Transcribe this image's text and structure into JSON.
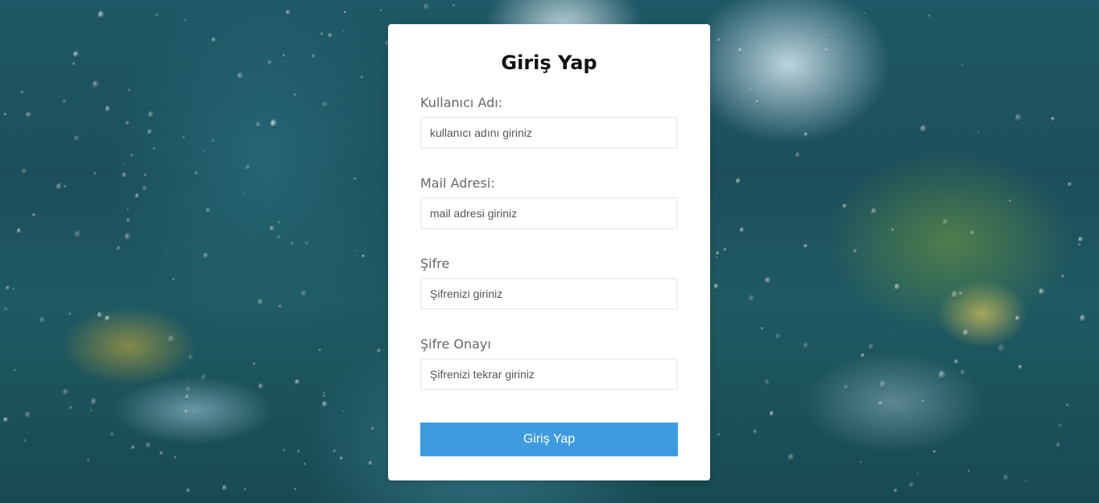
{
  "form": {
    "title": "Giriş Yap",
    "fields": [
      {
        "label": "Kullanıcı Adı:",
        "placeholder": "kullanıcı adını giriniz"
      },
      {
        "label": "Mail Adresi:",
        "placeholder": "mail adresi giriniz"
      },
      {
        "label": "Şifre",
        "placeholder": "Şifrenizi giriniz"
      },
      {
        "label": "Şifre Onayı",
        "placeholder": "Şifrenizi tekrar giriniz"
      }
    ],
    "submit_label": "Giriş Yap"
  },
  "colors": {
    "accent": "#3d9be0",
    "card": "#ffffff",
    "label": "#666666"
  }
}
